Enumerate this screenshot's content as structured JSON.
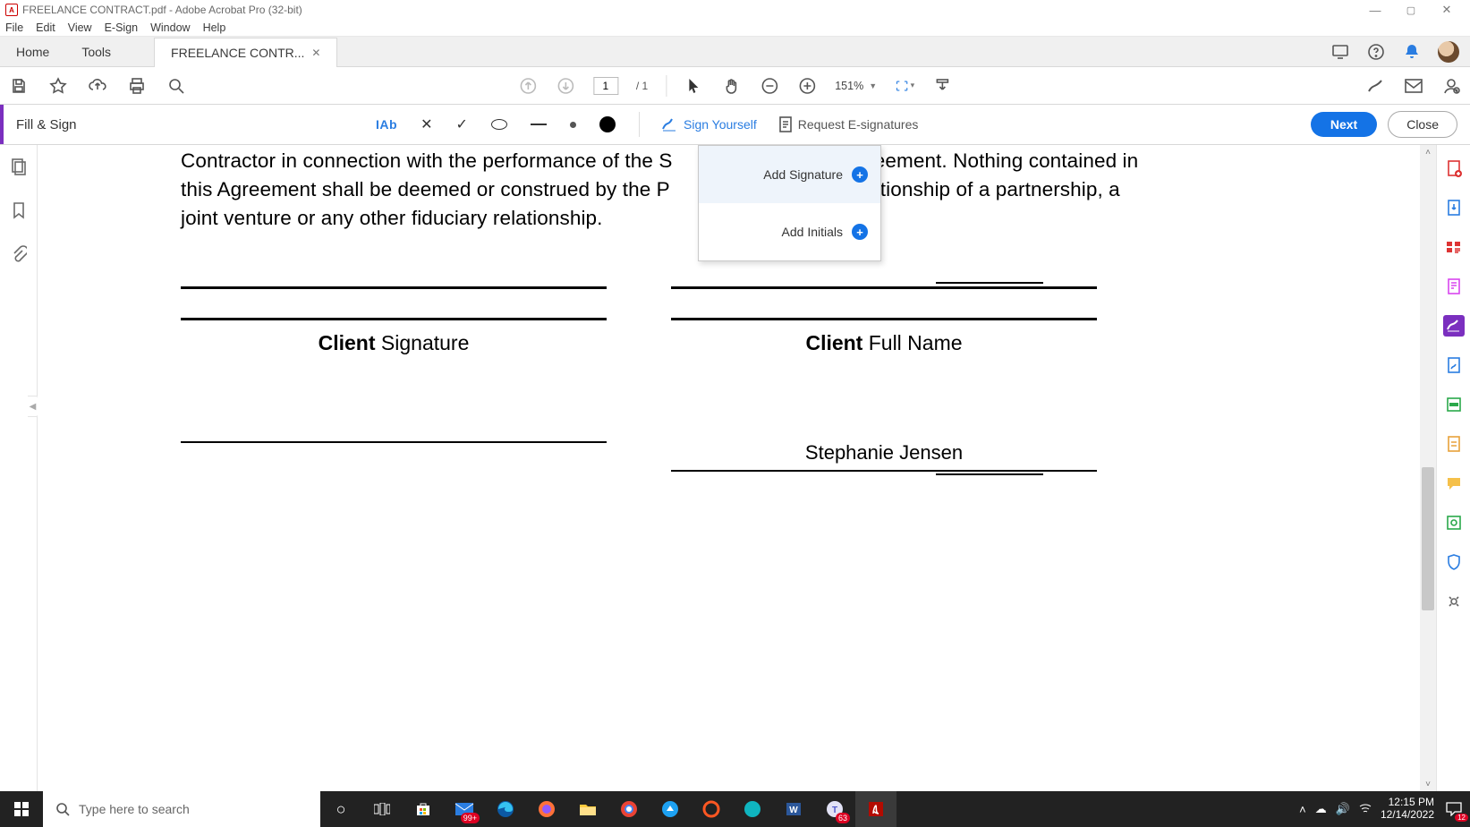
{
  "window": {
    "title": "FREELANCE CONTRACT.pdf - Adobe Acrobat Pro (32-bit)",
    "app_badge": "A"
  },
  "menubar": [
    "File",
    "Edit",
    "View",
    "E-Sign",
    "Window",
    "Help"
  ],
  "tabs": {
    "home": "Home",
    "tools": "Tools",
    "doc": "FREELANCE CONTR..."
  },
  "toolbar2": {
    "page_current": "1",
    "page_total": "/ 1",
    "zoom": "151%"
  },
  "fillsign": {
    "label": "Fill & Sign",
    "iab": "IAb",
    "sign_self": "Sign Yourself",
    "request_esig": "Request E-signatures",
    "next": "Next",
    "close": "Close"
  },
  "sign_popup": {
    "add_signature": "Add Signature",
    "add_initials": "Add Initials"
  },
  "document": {
    "para_left": "Contractor in connection with the performance of the S",
    "para_right_top": "reement. Nothing contained in",
    "para_line2_left": "this Agreement shall be deemed or construed by the P",
    "para_line2_right": "lationship of a partnership, a",
    "para_line3": "joint venture or any other fiduciary relationship.",
    "client_sig_bold": "Client",
    "client_sig_rest": " Signature",
    "client_name_bold": "Client",
    "client_name_rest": " Full Name",
    "freelancer_name": "Stephanie Jensen"
  },
  "taskbar": {
    "search_placeholder": "Type here to search",
    "store_badge": "99+",
    "teams_badge": "63",
    "notif_badge": "12",
    "time": "12:15 PM",
    "date": "12/14/2022"
  },
  "icons": {
    "save": "save-icon",
    "star": "star-icon",
    "cloud": "cloud-upload-icon",
    "print": "print-icon",
    "magnify": "magnify-icon",
    "up": "arrow-up-circle-icon",
    "down": "arrow-down-circle-icon",
    "select": "cursor-icon",
    "hand": "hand-icon",
    "minus": "zoom-out-icon",
    "plus": "zoom-in-icon",
    "fitw": "fit-width-icon",
    "reflow": "reflow-icon",
    "pen": "pen-icon",
    "mail": "mail-icon",
    "profile": "profile-add-icon",
    "share": "share-screen-icon",
    "help": "help-icon",
    "bell": "bell-icon",
    "pages": "page-thumbnails-icon",
    "bookmark": "bookmark-icon",
    "attach": "attachment-icon",
    "r_createpdf": "create-pdf-icon",
    "r_export": "export-pdf-icon",
    "r_organize": "organize-pages-icon",
    "r_editpdf": "edit-pdf-icon",
    "r_fillsign": "fill-sign-icon",
    "r_sendsign": "request-signatures-icon",
    "r_redact": "redact-icon",
    "r_compress": "compress-icon",
    "r_comment": "comment-icon",
    "r_scan": "scan-ocr-icon",
    "r_protect": "protect-icon",
    "r_moretools": "more-tools-icon"
  }
}
